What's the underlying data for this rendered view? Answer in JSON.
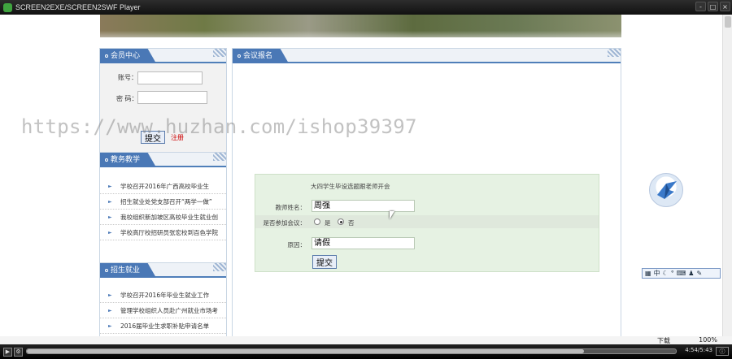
{
  "window": {
    "title": "SCREEN2EXE/SCREEN2SWF Player",
    "buttons": [
      "-",
      "□",
      "×"
    ]
  },
  "login": {
    "heading": "会员中心",
    "account_label": "账号：",
    "password_label": "密  码：",
    "submit_label": "提交",
    "register_label": "注册"
  },
  "teaching": {
    "heading": "教务教学",
    "items": [
      "学校召开2016年广西高校毕业生",
      "招生就业处党支部召开“两学一做”",
      "我校组织新加坡区高校毕业生就业创",
      "学校高厅校招研员张宏校到百色学院"
    ]
  },
  "jobs": {
    "heading": "招生就业",
    "items": [
      "学校召开2016年毕业生就业工作",
      "管理学校组织人员赴广州就业市场考",
      "2016届毕业生求职补贴申请名单",
      ""
    ]
  },
  "registration": {
    "heading": "会议报名",
    "meeting_title": "大四学生毕设选题跟老师开会",
    "teacher_label": "教师姓名：",
    "teacher_value": "周强",
    "attend_label": "是否参加会议：",
    "yes_label": "是",
    "no_label": "否",
    "attend_selected": "否",
    "reason_label": "原因：",
    "reason_value": "请假",
    "submit_label": "提交"
  },
  "watermark": "https://www.huzhan.com/ishop39397",
  "ime_bar": {
    "text": "中"
  },
  "status": {
    "download": "下载",
    "zoom": "100%"
  },
  "player": {
    "time": "4:54/5:43",
    "progress": 0.858
  }
}
